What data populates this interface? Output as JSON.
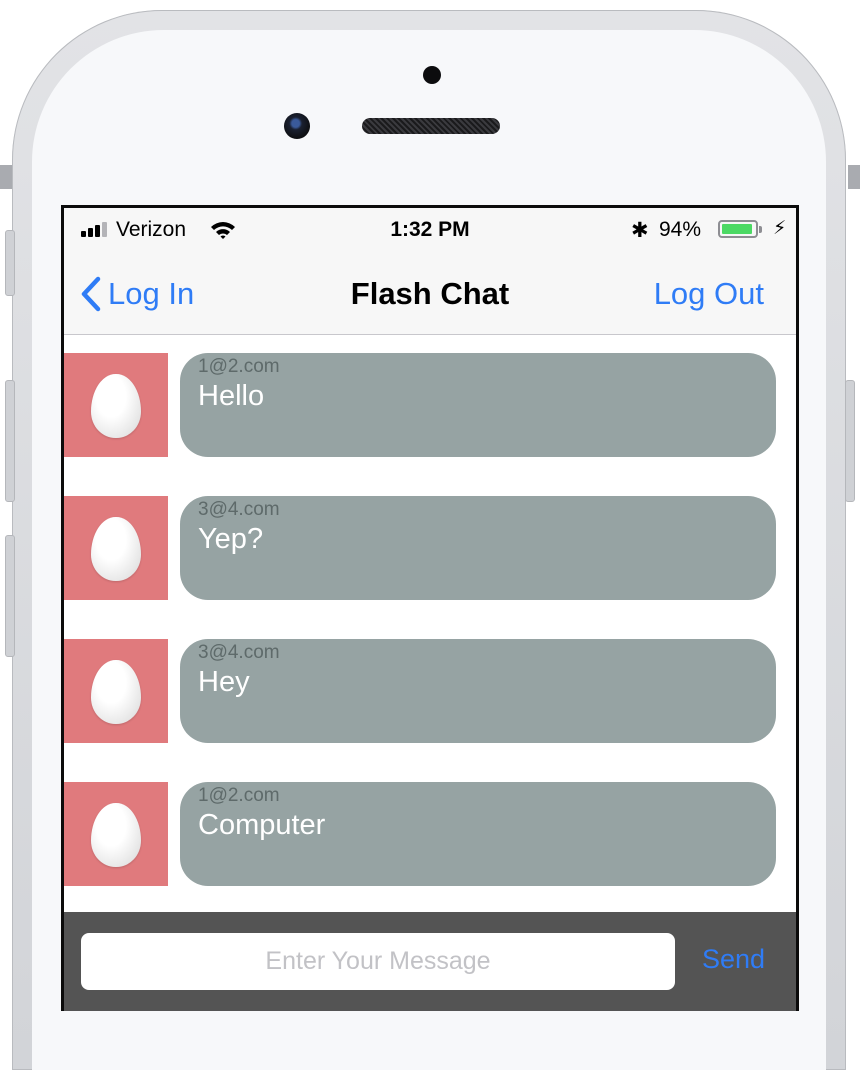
{
  "statusbar": {
    "carrier": "Verizon",
    "time": "1:32 PM",
    "battery_percent": "94%",
    "battery_level": 0.94,
    "icons": [
      "signal-icon",
      "wifi-icon",
      "bluetooth-icon",
      "battery-icon",
      "charging-icon"
    ]
  },
  "navbar": {
    "back_label": "Log In",
    "title": "Flash Chat",
    "right_label": "Log Out"
  },
  "messages": [
    {
      "sender": "1@2.com",
      "text": "Hello"
    },
    {
      "sender": "3@4.com",
      "text": "Yep?"
    },
    {
      "sender": "3@4.com",
      "text": "Hey"
    },
    {
      "sender": "1@2.com",
      "text": "Computer"
    }
  ],
  "composer": {
    "placeholder": "Enter Your Message",
    "value": "",
    "send_label": "Send"
  },
  "colors": {
    "accent": "#2f7cf6",
    "avatar_bg": "#e07a7d",
    "bubble_bg": "#96a3a3",
    "composer_bg": "#545454",
    "battery_fill": "#4cd964"
  }
}
